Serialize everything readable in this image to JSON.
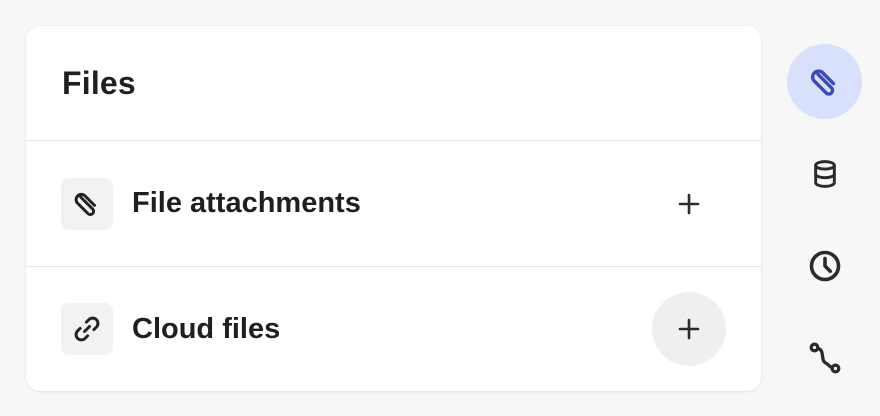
{
  "panel": {
    "title": "Files",
    "rows": [
      {
        "label": "File attachments",
        "icon": "paperclip-icon",
        "action_icon": "plus-icon"
      },
      {
        "label": "Cloud files",
        "icon": "link-icon",
        "action_icon": "plus-icon"
      }
    ]
  },
  "rail": {
    "items": [
      {
        "icon": "paperclip-icon",
        "active": true
      },
      {
        "icon": "database-icon",
        "active": false
      },
      {
        "icon": "clock-icon",
        "active": false
      },
      {
        "icon": "workflow-icon",
        "active": false
      }
    ]
  },
  "colors": {
    "accent": "#3b4bb0",
    "accent_bg": "#d9e0fb",
    "text": "#1f1f1f",
    "icon": "#2b2b2b"
  }
}
